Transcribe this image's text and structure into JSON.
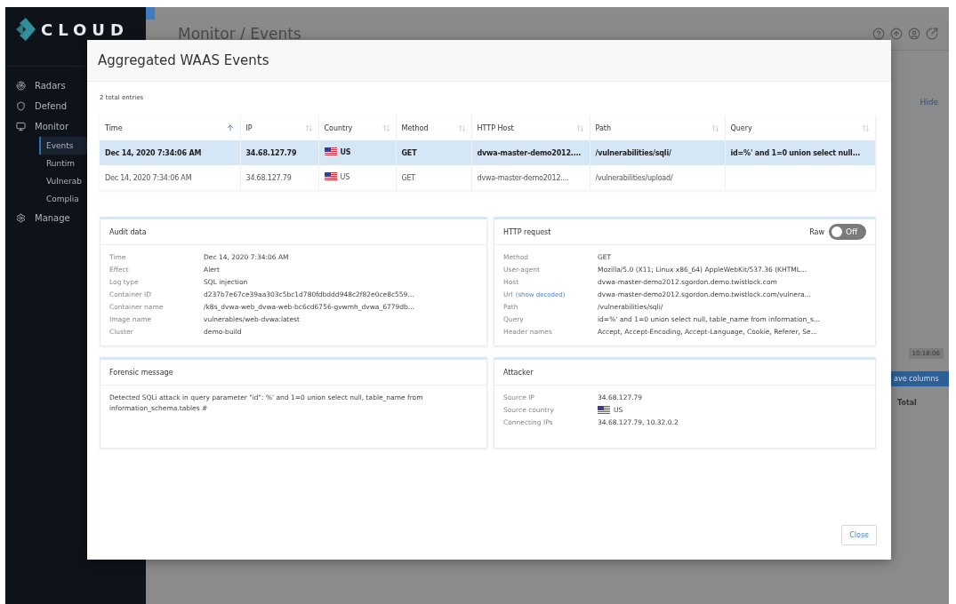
{
  "app": {
    "logo": "CLOUD",
    "page_title": "Monitor / Events"
  },
  "sidebar": {
    "items": [
      {
        "label": "Radars",
        "selected": false
      },
      {
        "label": "Defend",
        "selected": false
      },
      {
        "label": "Monitor",
        "selected": false,
        "children": [
          {
            "label": "Events",
            "selected": true
          },
          {
            "label": "Runtim",
            "selected": false
          },
          {
            "label": "Vulnerab",
            "selected": false
          },
          {
            "label": "Complia",
            "selected": false
          }
        ]
      },
      {
        "label": "Manage",
        "selected": false
      }
    ]
  },
  "background": {
    "hide_link": "Hide",
    "time_cell": "10:18:06",
    "columns_button": "ave columns",
    "total_header": "Total"
  },
  "modal": {
    "title": "Aggregated WAAS Events",
    "count": "2 total entries",
    "table": {
      "columns": [
        {
          "label": "Time",
          "sorted": true
        },
        {
          "label": "IP",
          "sorted": false
        },
        {
          "label": "Country",
          "sorted": false
        },
        {
          "label": "Method",
          "sorted": false
        },
        {
          "label": "HTTP Host",
          "sorted": false
        },
        {
          "label": "Path",
          "sorted": false
        },
        {
          "label": "Query",
          "sorted": false
        }
      ],
      "rows": [
        {
          "selected": true,
          "cells": [
            "Dec 14, 2020 7:34:06 AM",
            "34.68.127.79",
            "US",
            "GET",
            "dvwa-master-demo2012....",
            "/vulnerabilities/sqli/",
            "id=%' and 1=0 union select null..."
          ]
        },
        {
          "selected": false,
          "cells": [
            "Dec 14, 2020 7:34:06 AM",
            "34.68.127.79",
            "US",
            "GET",
            "dvwa-master-demo2012....",
            "/vulnerabilities/upload/",
            null
          ]
        }
      ]
    },
    "audit": {
      "title": "Audit data",
      "fields": [
        {
          "label": "Time",
          "value": "Dec 14, 2020 7:34:06 AM"
        },
        {
          "label": "Effect",
          "value": "Alert"
        },
        {
          "label": "Log type",
          "value": "SQL injection"
        },
        {
          "label": "Container ID",
          "value": "d237b7e67ce39aa303c5bc1d780fdbddd948c2f82e0ce8c559..."
        },
        {
          "label": "Container name",
          "value": "/k8s_dvwa-web_dvwa-web-bc6cd6756-gvwmh_dvwa_6779db..."
        },
        {
          "label": "Image name",
          "value": "vulnerables/web-dvwa:latest"
        },
        {
          "label": "Cluster",
          "value": "demo-build"
        }
      ]
    },
    "http_request": {
      "title": "HTTP request",
      "raw_toggle": {
        "label": "Raw",
        "on": false,
        "text": "Off"
      },
      "fields": [
        {
          "label": "Method",
          "value": "GET"
        },
        {
          "label": "User-agent",
          "value": "Mozilla/5.0 (X11; Linux x86_64) AppleWebKit/537.36 (KHTML..."
        },
        {
          "label": "Host",
          "value": "dvwa-master-demo2012.sgordon.demo.twistlock.com"
        },
        {
          "label": "Url",
          "link": "(show decoded)",
          "value": "dvwa-master-demo2012.sgordon.demo.twistlock.com/vulnera..."
        },
        {
          "label": "Path",
          "value": "/vulnerabilities/sqli/"
        },
        {
          "label": "Query",
          "value": "id=%' and 1=0 union select null, table_name from information_s..."
        },
        {
          "label": "Header names",
          "value": "Accept, Accept-Encoding, Accept-Language, Cookie, Referer, Se..."
        }
      ]
    },
    "forensic": {
      "title": "Forensic message",
      "text": "Detected SQLi attack in query parameter \"id\": %' and 1=0 union select null, table_name from information_schema.tables #"
    },
    "attacker": {
      "title": "Attacker",
      "fields": [
        {
          "label": "Source IP",
          "value": "34.68.127.79",
          "kind": "text"
        },
        {
          "label": "Source country",
          "value": "US",
          "kind": "country"
        },
        {
          "label": "Connecting IPs",
          "value": "34.68.127.79, 10.32.0.2",
          "kind": "text"
        }
      ]
    },
    "close_button": "Close"
  }
}
